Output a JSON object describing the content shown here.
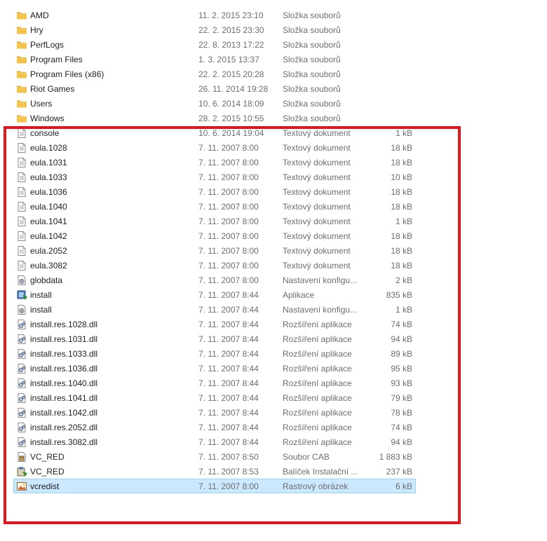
{
  "accent": {
    "highlight_border": "#e0161f",
    "selection_fill": "#cce8ff",
    "selection_border": "#99d1ff",
    "folder_color": "#f3c34b"
  },
  "files": [
    {
      "name": "AMD",
      "date": "11. 2. 2015 23:10",
      "type": "Složka souborů",
      "size": "",
      "icon": "folder-icon",
      "selected": false
    },
    {
      "name": "Hry",
      "date": "22. 2. 2015 23:30",
      "type": "Složka souborů",
      "size": "",
      "icon": "folder-icon",
      "selected": false
    },
    {
      "name": "PerfLogs",
      "date": "22. 8. 2013 17:22",
      "type": "Složka souborů",
      "size": "",
      "icon": "folder-icon",
      "selected": false
    },
    {
      "name": "Program Files",
      "date": "1. 3. 2015 13:37",
      "type": "Složka souborů",
      "size": "",
      "icon": "folder-icon",
      "selected": false
    },
    {
      "name": "Program Files (x86)",
      "date": "22. 2. 2015 20:28",
      "type": "Složka souborů",
      "size": "",
      "icon": "folder-icon",
      "selected": false
    },
    {
      "name": "Riot Games",
      "date": "26. 11. 2014 19:28",
      "type": "Složka souborů",
      "size": "",
      "icon": "folder-icon",
      "selected": false
    },
    {
      "name": "Users",
      "date": "10. 6. 2014 18:09",
      "type": "Složka souborů",
      "size": "",
      "icon": "folder-icon",
      "selected": false
    },
    {
      "name": "Windows",
      "date": "28. 2. 2015 10:55",
      "type": "Složka souborů",
      "size": "",
      "icon": "folder-icon",
      "selected": false
    },
    {
      "name": "console",
      "date": "10. 6. 2014 19:04",
      "type": "Textový dokument",
      "size": "1 kB",
      "icon": "text-document-icon",
      "selected": false
    },
    {
      "name": "eula.1028",
      "date": "7. 11. 2007 8:00",
      "type": "Textový dokument",
      "size": "18 kB",
      "icon": "text-document-icon",
      "selected": false
    },
    {
      "name": "eula.1031",
      "date": "7. 11. 2007 8:00",
      "type": "Textový dokument",
      "size": "18 kB",
      "icon": "text-document-icon",
      "selected": false
    },
    {
      "name": "eula.1033",
      "date": "7. 11. 2007 8:00",
      "type": "Textový dokument",
      "size": "10 kB",
      "icon": "text-document-icon",
      "selected": false
    },
    {
      "name": "eula.1036",
      "date": "7. 11. 2007 8:00",
      "type": "Textový dokument",
      "size": "18 kB",
      "icon": "text-document-icon",
      "selected": false
    },
    {
      "name": "eula.1040",
      "date": "7. 11. 2007 8:00",
      "type": "Textový dokument",
      "size": "18 kB",
      "icon": "text-document-icon",
      "selected": false
    },
    {
      "name": "eula.1041",
      "date": "7. 11. 2007 8:00",
      "type": "Textový dokument",
      "size": "1 kB",
      "icon": "text-document-icon",
      "selected": false
    },
    {
      "name": "eula.1042",
      "date": "7. 11. 2007 8:00",
      "type": "Textový dokument",
      "size": "18 kB",
      "icon": "text-document-icon",
      "selected": false
    },
    {
      "name": "eula.2052",
      "date": "7. 11. 2007 8:00",
      "type": "Textový dokument",
      "size": "18 kB",
      "icon": "text-document-icon",
      "selected": false
    },
    {
      "name": "eula.3082",
      "date": "7. 11. 2007 8:00",
      "type": "Textový dokument",
      "size": "18 kB",
      "icon": "text-document-icon",
      "selected": false
    },
    {
      "name": "globdata",
      "date": "7. 11. 2007 8:00",
      "type": "Nastavení konfigu...",
      "size": "2 kB",
      "icon": "config-settings-icon",
      "selected": false
    },
    {
      "name": "install",
      "date": "7. 11. 2007 8:44",
      "type": "Aplikace",
      "size": "835 kB",
      "icon": "installer-application-icon",
      "selected": false
    },
    {
      "name": "install",
      "date": "7. 11. 2007 8:44",
      "type": "Nastavení konfigu...",
      "size": "1 kB",
      "icon": "config-settings-icon",
      "selected": false
    },
    {
      "name": "install.res.1028.dll",
      "date": "7. 11. 2007 8:44",
      "type": "Rozšíření aplikace",
      "size": "74 kB",
      "icon": "dll-extension-icon",
      "selected": false
    },
    {
      "name": "install.res.1031.dll",
      "date": "7. 11. 2007 8:44",
      "type": "Rozšíření aplikace",
      "size": "94 kB",
      "icon": "dll-extension-icon",
      "selected": false
    },
    {
      "name": "install.res.1033.dll",
      "date": "7. 11. 2007 8:44",
      "type": "Rozšíření aplikace",
      "size": "89 kB",
      "icon": "dll-extension-icon",
      "selected": false
    },
    {
      "name": "install.res.1036.dll",
      "date": "7. 11. 2007 8:44",
      "type": "Rozšíření aplikace",
      "size": "95 kB",
      "icon": "dll-extension-icon",
      "selected": false
    },
    {
      "name": "install.res.1040.dll",
      "date": "7. 11. 2007 8:44",
      "type": "Rozšíření aplikace",
      "size": "93 kB",
      "icon": "dll-extension-icon",
      "selected": false
    },
    {
      "name": "install.res.1041.dll",
      "date": "7. 11. 2007 8:44",
      "type": "Rozšíření aplikace",
      "size": "79 kB",
      "icon": "dll-extension-icon",
      "selected": false
    },
    {
      "name": "install.res.1042.dll",
      "date": "7. 11. 2007 8:44",
      "type": "Rozšíření aplikace",
      "size": "78 kB",
      "icon": "dll-extension-icon",
      "selected": false
    },
    {
      "name": "install.res.2052.dll",
      "date": "7. 11. 2007 8:44",
      "type": "Rozšíření aplikace",
      "size": "74 kB",
      "icon": "dll-extension-icon",
      "selected": false
    },
    {
      "name": "install.res.3082.dll",
      "date": "7. 11. 2007 8:44",
      "type": "Rozšíření aplikace",
      "size": "94 kB",
      "icon": "dll-extension-icon",
      "selected": false
    },
    {
      "name": "VC_RED",
      "date": "7. 11. 2007 8:50",
      "type": "Soubor CAB",
      "size": "1 883 kB",
      "icon": "cab-archive-icon",
      "selected": false
    },
    {
      "name": "VC_RED",
      "date": "7. 11. 2007 8:53",
      "type": "Balíček Instalační ...",
      "size": "237 kB",
      "icon": "msi-package-icon",
      "selected": false
    },
    {
      "name": "vcredist",
      "date": "7. 11. 2007 8:00",
      "type": "Rastrový obrázek",
      "size": "6 kB",
      "icon": "bitmap-image-icon",
      "selected": true
    }
  ]
}
